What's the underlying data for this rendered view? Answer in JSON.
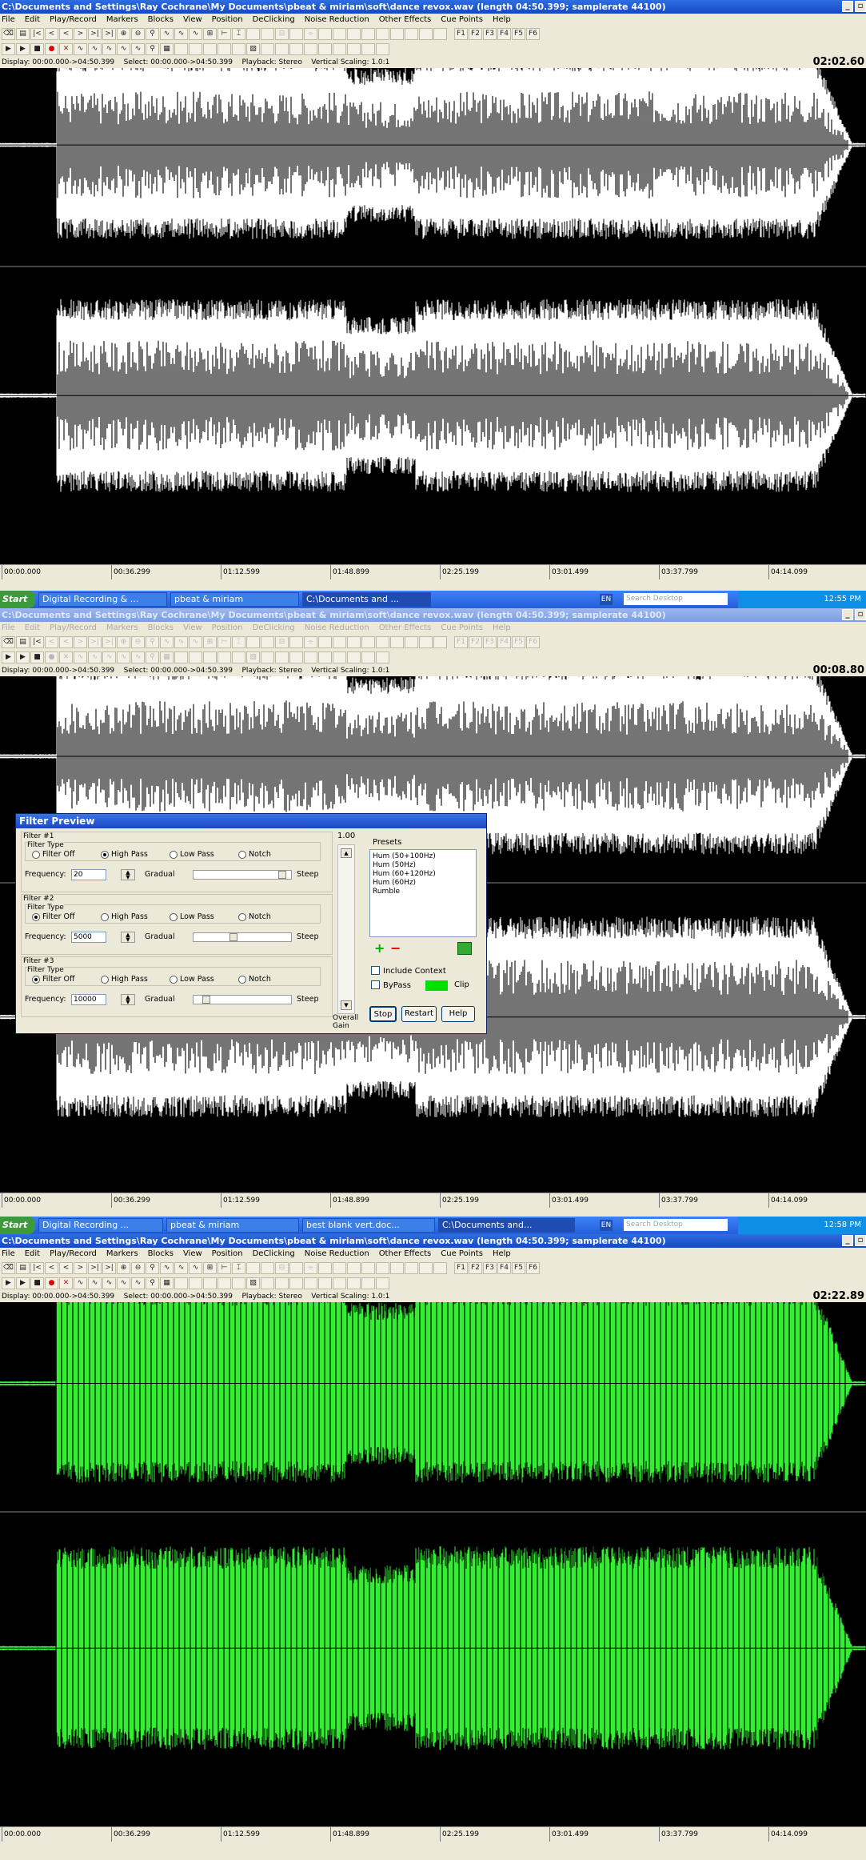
{
  "windows": [
    {
      "title": "C:\\Documents and Settings\\Ray Cochrane\\My Documents\\pbeat & miriam\\soft\\dance revox.wav (length 04:50.399; samplerate 44100)",
      "time": "02:02.60"
    },
    {
      "title": "C:\\Documents and Settings\\Ray Cochrane\\My Documents\\pbeat & miriam\\soft\\dance revox.wav (length 04:50.399; samplerate 44100)",
      "time": "00:08.80"
    },
    {
      "title": "C:\\Documents and Settings\\Ray Cochrane\\My Documents\\pbeat & miriam\\soft\\dance revox.wav (length 04:50.399; samplerate 44100)",
      "time": "02:22.89"
    }
  ],
  "menu": [
    "File",
    "Edit",
    "Play/Record",
    "Markers",
    "Blocks",
    "View",
    "Position",
    "DeClicking",
    "Noise Reduction",
    "Other Effects",
    "Cue Points",
    "Help"
  ],
  "fkeys": [
    "F1",
    "F2",
    "F3",
    "F4",
    "F5",
    "F6"
  ],
  "info": {
    "display": "Display: 00:00.000->04:50.399",
    "select": "Select: 00:00.000->04:50.399",
    "playback": "Playback: Stereo",
    "scaling": "Vertical Scaling: 1.0:1"
  },
  "timeline": [
    "00:00.000",
    "00:36.299",
    "01:12.599",
    "01:48.899",
    "02:25.199",
    "03:01.499",
    "03:37.799",
    "04:14.099"
  ],
  "taskbars": [
    {
      "start": "Start",
      "tasks": [
        "Digital Recording & ...",
        "pbeat & miriam",
        "C:\\Documents and ..."
      ],
      "search": "Search Desktop",
      "lang": "EN",
      "clock": "12:55 PM"
    },
    {
      "start": "Start",
      "tasks": [
        "Digital Recording ...",
        "pbeat & miriam",
        "best blank vert.doc...",
        "C:\\Documents and..."
      ],
      "search": "Search Desktop",
      "lang": "EN",
      "clock": "12:58 PM"
    }
  ],
  "filter_dialog": {
    "title": "Filter Preview",
    "filters": [
      {
        "label": "Filter #1",
        "type_label": "Filter Type",
        "options": [
          "Filter Off",
          "High Pass",
          "Low Pass",
          "Notch"
        ],
        "selected": 1,
        "freq_label": "Frequency:",
        "freq": "20",
        "gradual": "Gradual",
        "steep": "Steep",
        "slider": 0.95
      },
      {
        "label": "Filter #2",
        "type_label": "Filter Type",
        "options": [
          "Filter Off",
          "High Pass",
          "Low Pass",
          "Notch"
        ],
        "selected": 0,
        "freq_label": "Frequency:",
        "freq": "5000",
        "gradual": "Gradual",
        "steep": "Steep",
        "slider": 0.4
      },
      {
        "label": "Filter #3",
        "type_label": "Filter Type",
        "options": [
          "Filter Off",
          "High Pass",
          "Low Pass",
          "Notch"
        ],
        "selected": 0,
        "freq_label": "Frequency:",
        "freq": "10000",
        "gradual": "Gradual",
        "steep": "Steep",
        "slider": 0.1
      }
    ],
    "gain_value": "1.00",
    "gain_label": "Overall Gain",
    "presets_label": "Presets",
    "presets": [
      "Hum (50+100Hz)",
      "Hum (50Hz)",
      "Hum (60+120Hz)",
      "Hum (60Hz)",
      "Rumble"
    ],
    "include_context": "Include Context",
    "bypass": "ByPass",
    "clip": "Clip",
    "buttons": [
      "Stop",
      "Restart",
      "Help"
    ]
  },
  "colors": {
    "wave_white": "#ffffff",
    "wave_green": "#33ee33",
    "grid": "#8a8a8a"
  }
}
